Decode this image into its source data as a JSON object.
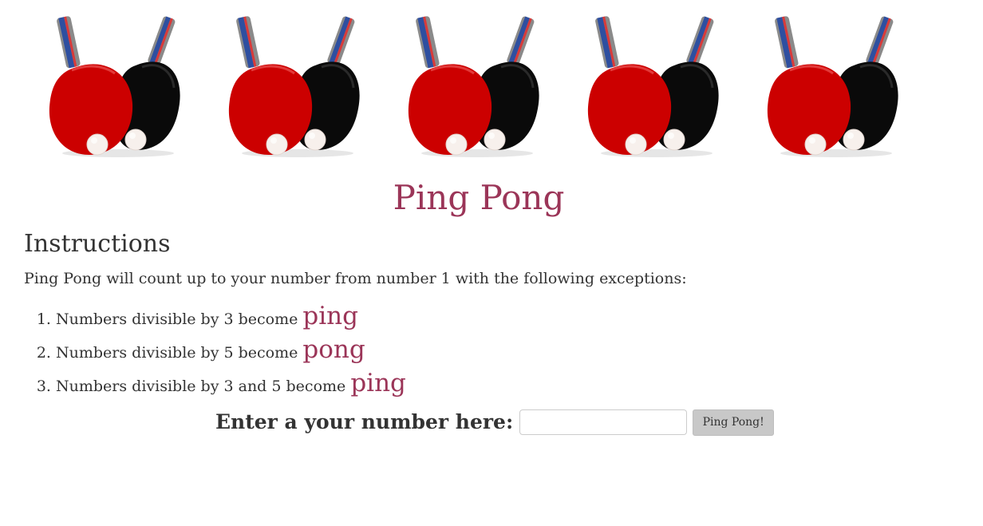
{
  "banner": {
    "image_count": 5,
    "image_name": "ping-pong-paddles-image"
  },
  "header": {
    "title": "Ping Pong"
  },
  "instructions": {
    "heading": "Instructions",
    "intro": "Ping Pong will count up to your number from number 1 with the following exceptions:",
    "rules": [
      {
        "text": "Numbers divisible by 3 become ",
        "keyword": "ping"
      },
      {
        "text": "Numbers divisible by 5 become ",
        "keyword": "pong"
      },
      {
        "text": "Numbers divisible by 3 and 5 become ",
        "keyword": "ping"
      }
    ]
  },
  "form": {
    "label": "Enter a your number here:",
    "input_value": "",
    "input_placeholder": "",
    "button_label": "Ping Pong!"
  },
  "colors": {
    "accent": "#9b3558",
    "text": "#333333",
    "button": "#c8c8c8"
  }
}
